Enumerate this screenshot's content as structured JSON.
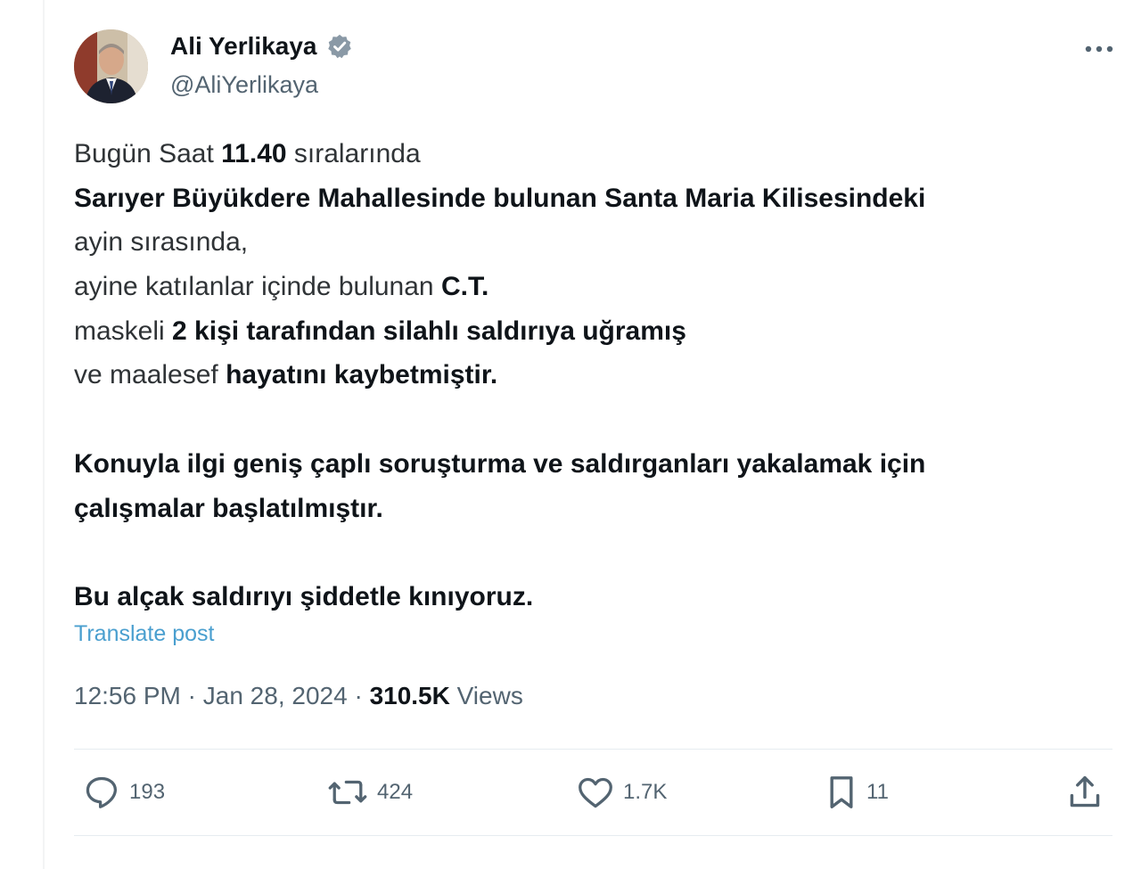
{
  "author": {
    "name": "Ali Yerlikaya",
    "handle": "@AliYerlikaya",
    "verified": true,
    "verified_color": "#8a99a6"
  },
  "post": {
    "lines": [
      [
        {
          "t": "Bugün Saat ",
          "b": false
        },
        {
          "t": "11.40",
          "b": true
        },
        {
          "t": " sıralarında",
          "b": false
        }
      ],
      [
        {
          "t": "Sarıyer Büyükdere Mahallesinde bulunan Santa Maria Kilisesindeki",
          "b": true
        }
      ],
      [
        {
          "t": "ayin sırasında,",
          "b": false
        }
      ],
      [
        {
          "t": "ayine katılanlar içinde bulunan ",
          "b": false
        },
        {
          "t": "C.T.",
          "b": true
        }
      ],
      [
        {
          "t": "maskeli ",
          "b": false
        },
        {
          "t": "2 kişi tarafından silahlı saldırıya uğramış",
          "b": true
        }
      ],
      [
        {
          "t": "ve maalesef ",
          "b": false
        },
        {
          "t": "hayatını kaybetmiştir.",
          "b": true
        }
      ],
      [],
      [
        {
          "t": "Konuyla ilgi geniş çaplı soruşturma ve saldırganları yakalamak için",
          "b": true
        }
      ],
      [
        {
          "t": "çalışmalar başlatılmıştır.",
          "b": true
        }
      ],
      [],
      [
        {
          "t": "Bu alçak saldırıyı şiddetle kınıyoruz.",
          "b": true
        }
      ]
    ],
    "translate_label": "Translate post",
    "time": "12:56 PM",
    "separator": "·",
    "date": "Jan 28, 2024",
    "views_count": "310.5K",
    "views_label": "Views"
  },
  "actions": {
    "replies": "193",
    "reposts": "424",
    "likes": "1.7K",
    "bookmarks": "11"
  },
  "icons": {
    "more": "more-horizontal-icon",
    "reply": "reply-bubble-icon",
    "repost": "repost-icon",
    "like": "heart-icon",
    "bookmark": "bookmark-icon",
    "share": "share-upload-icon"
  },
  "colors": {
    "text": "#0f1419",
    "secondary": "#536471",
    "link": "#4a9fcf",
    "divider": "#e6ecf0"
  }
}
